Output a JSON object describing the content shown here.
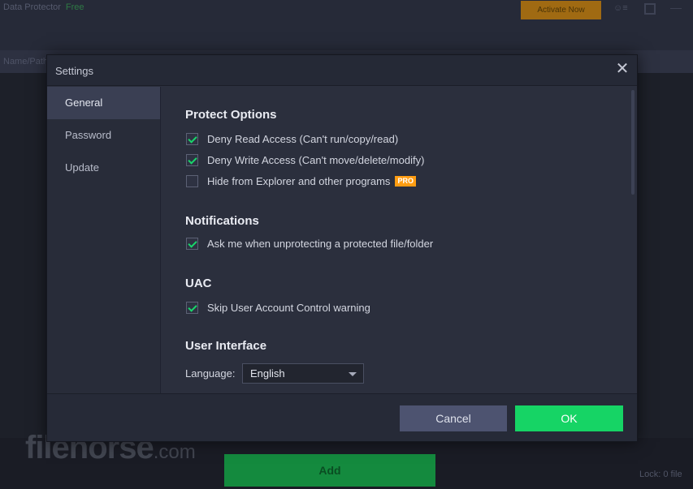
{
  "background_app": {
    "title": "Data Protector",
    "free_label": "Free",
    "activate_label": "Activate Now",
    "column_header": "Name/Path",
    "add_button": "Add",
    "bottom_right_text": "Lock: 0 file",
    "watermark_main": "filehorse",
    "watermark_suffix": ".com"
  },
  "dialog": {
    "title": "Settings",
    "close_glyph": "✕"
  },
  "sidebar": {
    "items": [
      {
        "label": "General",
        "active": true
      },
      {
        "label": "Password",
        "active": false
      },
      {
        "label": "Update",
        "active": false
      }
    ]
  },
  "protect_options": {
    "title": "Protect Options",
    "items": [
      {
        "label": "Deny Read Access (Can't run/copy/read)",
        "checked": true
      },
      {
        "label": "Deny Write Access (Can't move/delete/modify)",
        "checked": true
      },
      {
        "label": "Hide from Explorer and other programs",
        "checked": false,
        "badge": "PRO"
      }
    ]
  },
  "notifications": {
    "title": "Notifications",
    "items": [
      {
        "label": "Ask me when unprotecting a protected file/folder",
        "checked": true
      }
    ]
  },
  "uac": {
    "title": "UAC",
    "items": [
      {
        "label": "Skip User Account Control warning",
        "checked": true
      }
    ]
  },
  "user_interface": {
    "title": "User Interface",
    "language_label": "Language:",
    "language_value": "English"
  },
  "footer": {
    "cancel_label": "Cancel",
    "ok_label": "OK"
  },
  "colors": {
    "accent_green": "#16d465",
    "pro_orange": "#ff9d12",
    "cancel_bg": "#4d5370"
  }
}
